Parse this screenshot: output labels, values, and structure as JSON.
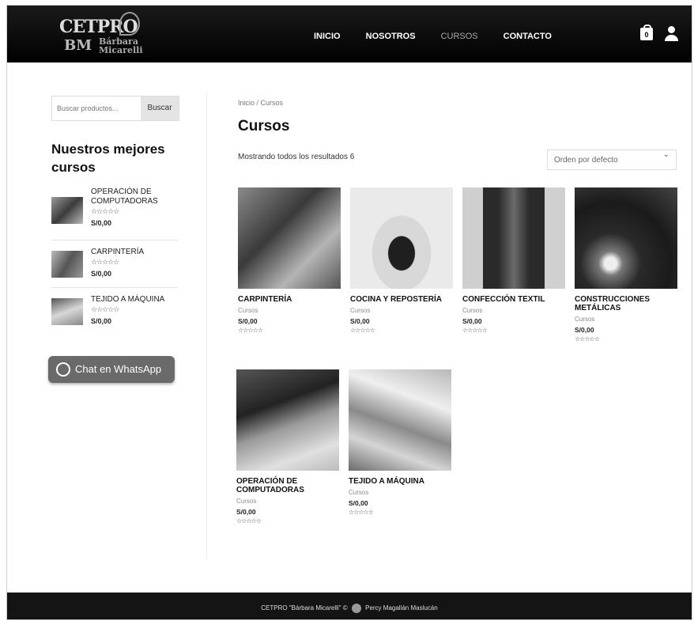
{
  "header": {
    "logo": {
      "line1": "CETPRO",
      "line2": "BM",
      "name1": "Bárbara",
      "name2": "Micarelli"
    },
    "nav": [
      {
        "label": "INICIO",
        "active": false
      },
      {
        "label": "NOSOTROS",
        "active": false
      },
      {
        "label": "CURSOS",
        "active": true
      },
      {
        "label": "CONTACTO",
        "active": false
      }
    ],
    "cart_count": "0"
  },
  "sidebar": {
    "search": {
      "placeholder": "Buscar productos...",
      "button_label": "Buscar"
    },
    "title": "Nuestros mejores cursos",
    "items": [
      {
        "title": "OPERACIÓN DE COMPUTADORAS",
        "stars": "☆☆☆☆☆",
        "price": "S/0,00"
      },
      {
        "title": "CARPINTERÍA",
        "stars": "☆☆☆☆☆",
        "price": "S/0,00"
      },
      {
        "title": "TEJIDO A MÁQUINA",
        "stars": "☆☆☆☆☆",
        "price": "S/0,00"
      }
    ],
    "whatsapp_label": "Chat en WhatsApp"
  },
  "main": {
    "breadcrumb": "Inicio / Cursos",
    "title": "Cursos",
    "results_text": "Mostrando todos los resultados 6",
    "sort_selected": "Orden por defecto",
    "products": [
      {
        "name": "CARPINTERÍA",
        "category": "Cursos",
        "price": "S/0,00",
        "stars": "☆☆☆☆☆"
      },
      {
        "name": "COCINA Y REPOSTERÍA",
        "category": "Cursos",
        "price": "S/0,00",
        "stars": "☆☆☆☆☆"
      },
      {
        "name": "CONFECCIÓN TEXTIL",
        "category": "Cursos",
        "price": "S/0,00",
        "stars": "☆☆☆☆☆"
      },
      {
        "name": "CONSTRUCCIONES METÁLICAS",
        "category": "Cursos",
        "price": "S/0,00",
        "stars": "☆☆☆☆☆"
      },
      {
        "name": "OPERACIÓN DE COMPUTADORAS",
        "category": "Cursos",
        "price": "S/0,00",
        "stars": "☆☆☆☆☆"
      },
      {
        "name": "TEJIDO A MÁQUINA",
        "category": "Cursos",
        "price": "S/0,00",
        "stars": "☆☆☆☆☆"
      }
    ]
  },
  "footer": {
    "text_before": "CETPRO \"Bárbara Micarelli\" ©",
    "text_after": "Percy Magallán Maslucán"
  }
}
